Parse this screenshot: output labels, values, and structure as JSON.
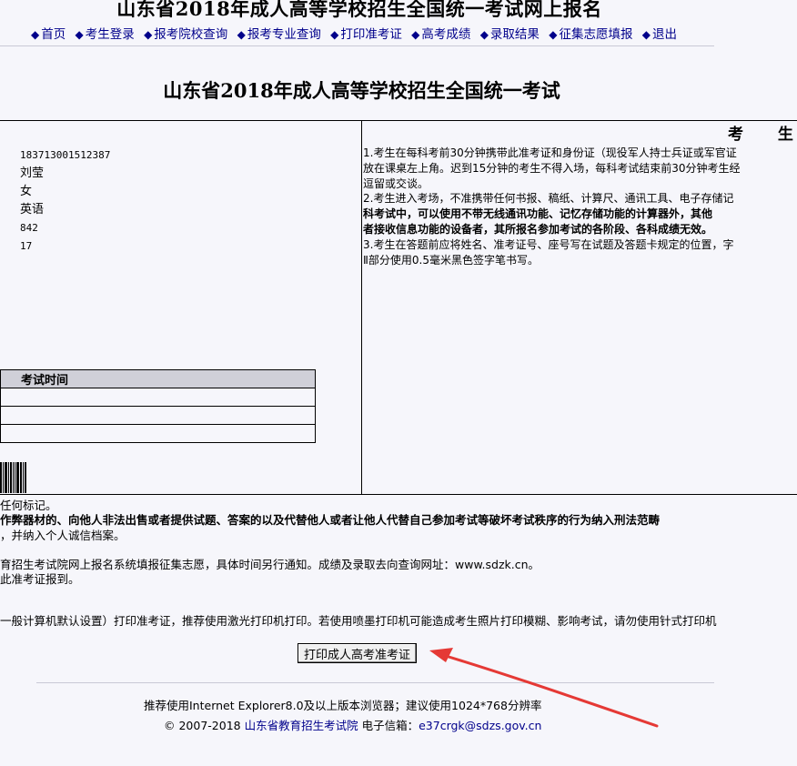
{
  "header": {
    "site_title": "山东省2018年成人高等学校招生全国统一考试网上报名",
    "nav": [
      "首页",
      "考生登录",
      "报考院校查询",
      "报考专业查询",
      "打印准考证",
      "高考成绩",
      "录取结果",
      "征集志愿填报",
      "退出"
    ]
  },
  "page_title": "山东省2018年成人高等学校招生全国统一考试",
  "candidate": {
    "exam_no": "183713001512387",
    "name": "刘莹",
    "gender": "女",
    "subject": "英语",
    "code": "842",
    "seat": "17"
  },
  "notice": {
    "heading": "考 生",
    "p1a": "1.考生在每科考前30分钟携带此准考证和身份证（现役军人持士兵证或军官证",
    "p1b": "放在课桌左上角。迟到15分钟的考生不得入场，每科考试结束前30分钟考生经",
    "p1c": "逗留或交谈。",
    "p2a": "2.考生进入考场，不准携带任何书报、稿纸、计算尺、通讯工具、电子存储记",
    "p2b": "科考试中，可以使用不带无线通讯功能、记忆存储功能的计算器外，其他",
    "p2c": "者接收信息功能的设备者，其所报名参加考试的各阶段、各科成绩无效。",
    "p3a": "3.考生在答题前应将姓名、准考证号、座号写在试题及答题卡规定的位置，字",
    "p3b": "Ⅱ部分使用0.5毫米黑色签字笔书写。"
  },
  "exam_table": {
    "header": "考试时间"
  },
  "lower": {
    "l1": "任何标记。",
    "l2": "作弊器材的、向他人非法出售或者提供试题、答案的以及代替他人或者让他人代替自己参加考试等破坏考试秩序的行为纳入刑法范畴",
    "l3": "，并纳入个人诚信档案。",
    "l4": "育招生考试院网上报名系统填报征集志愿，具体时间另行通知。成绩及录取去向查询网址：www.sdzk.cn。",
    "l5": "此准考证报到。"
  },
  "print_note": "一般计算机默认设置）打印准考证，推荐使用激光打印机打印。若使用喷墨打印机可能造成考生照片打印模糊、影响考试，请勿使用针式打印机",
  "print_button": "打印成人高考准考证",
  "footer": {
    "browser_tip": "推荐使用Internet Explorer8.0及以上版本浏览器；建议使用1024*768分辨率",
    "copyright": "© 2007-2018",
    "org": "山东省教育招生考试院",
    "email_label": "电子信箱：",
    "email": "e37crgk@sdzs.gov.cn"
  },
  "colors": {
    "link": "#00008b",
    "arrow": "#e53935",
    "background": "#f6f6fb"
  }
}
